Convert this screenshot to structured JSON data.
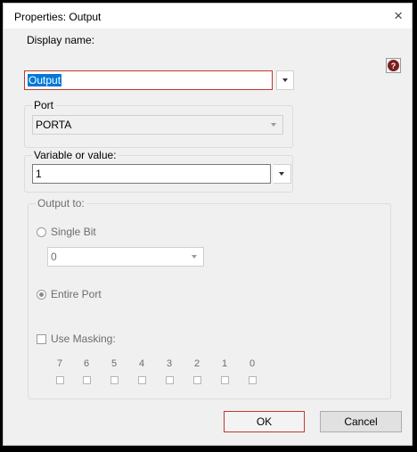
{
  "window": {
    "title": "Properties: Output",
    "close_glyph": "×"
  },
  "display_name": {
    "label": "Display name:",
    "value": "Output"
  },
  "port": {
    "label": "Port",
    "value": "PORTA"
  },
  "variable": {
    "label": "Variable or value:",
    "value": "1"
  },
  "output_to": {
    "label": "Output to:",
    "single_bit_label": "Single Bit",
    "bit_value": "0",
    "entire_port_label": "Entire Port",
    "use_masking_label": "Use Masking:",
    "bits": [
      "7",
      "6",
      "5",
      "4",
      "3",
      "2",
      "1",
      "0"
    ]
  },
  "buttons": {
    "ok": "OK",
    "cancel": "Cancel"
  },
  "icons": {
    "help": "help-icon",
    "close": "close-icon",
    "dropdown": "chevron-down-icon"
  },
  "colors": {
    "selection": "#0078d7",
    "focus_border": "#c0392b",
    "help_icon": "#7b1f1f"
  }
}
